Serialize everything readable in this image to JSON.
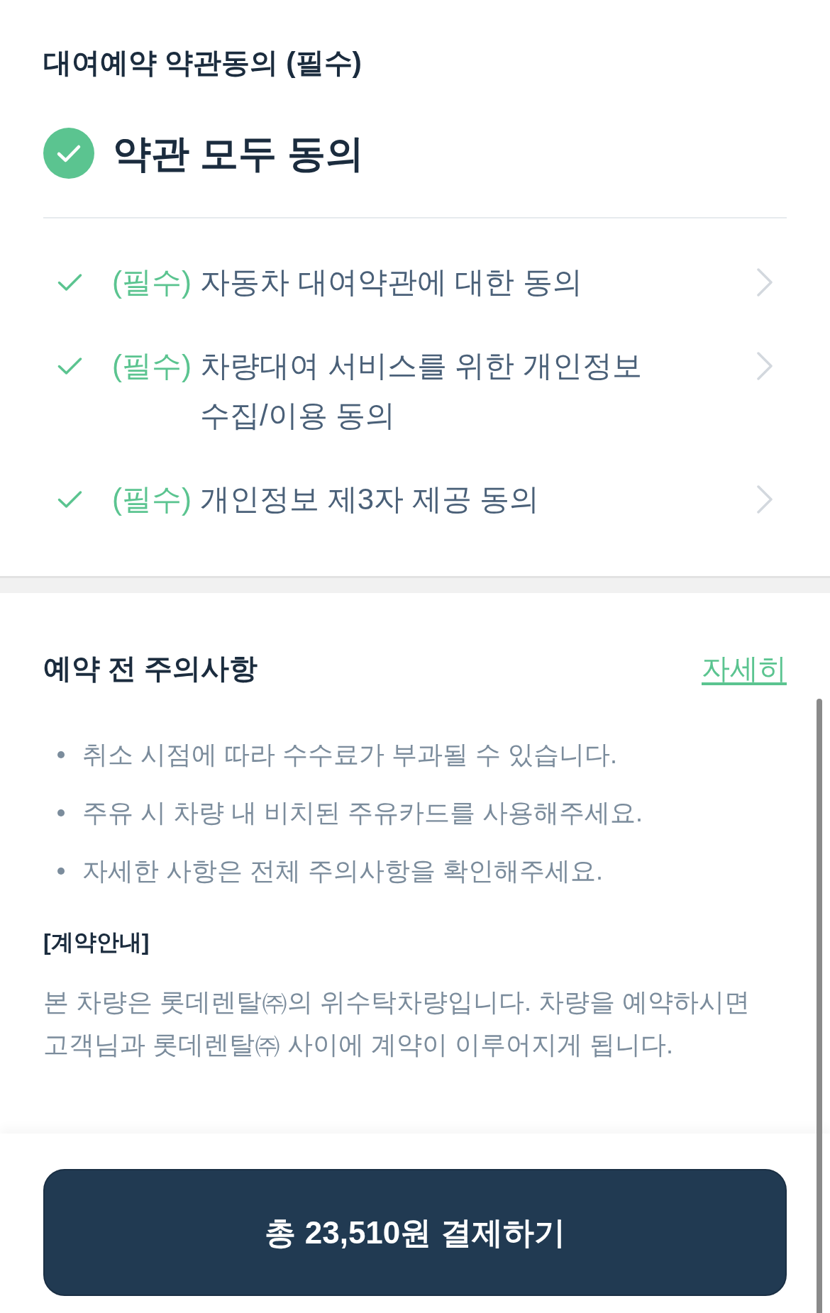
{
  "agreement": {
    "title": "대여예약 약관동의 (필수)",
    "agree_all": {
      "label": "약관 모두 동의",
      "checked": true
    },
    "items": [
      {
        "tag": "(필수)",
        "label": "자동차 대여약관에 대한 동의",
        "checked": true
      },
      {
        "tag": "(필수)",
        "label": "차량대여 서비스를 위한 개인정보 수집/이용 동의",
        "checked": true
      },
      {
        "tag": "(필수)",
        "label": "개인정보 제3자 제공 동의",
        "checked": true
      }
    ]
  },
  "notice": {
    "title": "예약 전 주의사항",
    "link": "자세히",
    "bullets": [
      "취소 시점에 따라 수수료가 부과될 수 있습니다.",
      "주유 시 차량 내 비치된 주유카드를 사용해주세요.",
      "자세한 사항은 전체 주의사항을 확인해주세요."
    ],
    "contract": {
      "title": "[계약안내]",
      "text": "본 차량은 롯데렌탈㈜의 위수탁차량입니다. 차량을 예약하시면 고객님과 롯데렌탈㈜ 사이에 계약이 이루어지게 됩니다."
    }
  },
  "pay_button": {
    "label": "총 23,510원 결제하기"
  }
}
